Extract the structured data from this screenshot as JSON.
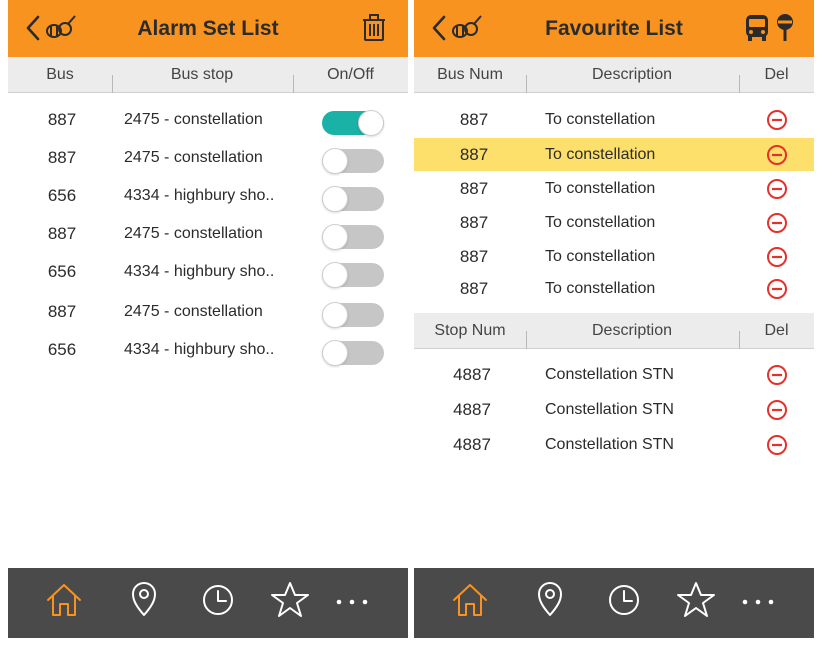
{
  "colors": {
    "header_bg": "#f7931e",
    "toggle_on": "#1ab1a6",
    "toggle_off": "#c6c6c6",
    "highlight_row": "#fde06b",
    "delete_red": "#e4322b",
    "tabbar_bg": "#4a4a4a",
    "tab_active": "#f7931e"
  },
  "alarm": {
    "title": "Alarm Set List",
    "back_icon": "chevron-left-icon",
    "logo_icon": "bee-logo-icon",
    "action_icon": "trash-icon",
    "columns": {
      "bus": "Bus",
      "stop": "Bus stop",
      "onoff": "On/Off"
    },
    "rows": [
      {
        "bus": "887",
        "stop": "2475 - constellation",
        "enabled": true
      },
      {
        "bus": "887",
        "stop": "2475 - constellation",
        "enabled": false
      },
      {
        "bus": "656",
        "stop": "4334 - highbury sho..",
        "enabled": false
      },
      {
        "bus": "887",
        "stop": "2475 - constellation",
        "enabled": false
      },
      {
        "bus": "656",
        "stop": "4334 - highbury sho..",
        "enabled": false
      },
      {
        "bus": "887",
        "stop": "2475 - constellation",
        "enabled": false
      },
      {
        "bus": "656",
        "stop": "4334 - highbury sho..",
        "enabled": false
      }
    ]
  },
  "favourite": {
    "title": "Favourite List",
    "back_icon": "chevron-left-icon",
    "logo_icon": "bee-logo-icon",
    "right_icons": [
      "bus-icon",
      "bus-stop-icon"
    ],
    "bus_columns": {
      "num": "Bus Num",
      "desc": "Description",
      "del": "Del"
    },
    "bus_rows": [
      {
        "num": "887",
        "desc": "To constellation",
        "highlighted": false
      },
      {
        "num": "887",
        "desc": "To constellation",
        "highlighted": true
      },
      {
        "num": "887",
        "desc": "To constellation",
        "highlighted": false
      },
      {
        "num": "887",
        "desc": "To constellation",
        "highlighted": false
      },
      {
        "num": "887",
        "desc": "To constellation",
        "highlighted": false
      },
      {
        "num": "887",
        "desc": "To constellation",
        "highlighted": false
      }
    ],
    "stop_columns": {
      "num": "Stop Num",
      "desc": "Description",
      "del": "Del"
    },
    "stop_rows": [
      {
        "num": "4887",
        "desc": "Constellation STN"
      },
      {
        "num": "4887",
        "desc": "Constellation STN"
      },
      {
        "num": "4887",
        "desc": "Constellation STN"
      }
    ]
  },
  "tabbar": {
    "active": "home",
    "tabs": [
      {
        "id": "home",
        "icon": "home-icon"
      },
      {
        "id": "location",
        "icon": "location-pin-icon"
      },
      {
        "id": "history",
        "icon": "clock-icon"
      },
      {
        "id": "favourites",
        "icon": "star-icon"
      },
      {
        "id": "more",
        "icon": "more-dots-icon"
      }
    ]
  }
}
